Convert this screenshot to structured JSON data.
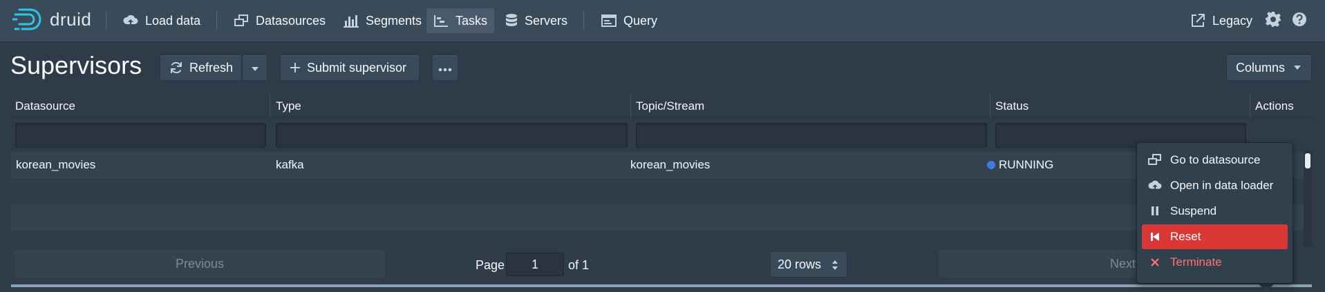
{
  "navbar": {
    "logo_text": "druid",
    "items": [
      {
        "label": "Load data",
        "icon": "cloud-upload-icon"
      },
      {
        "label": "Datasources",
        "icon": "multi-select-icon"
      },
      {
        "label": "Segments",
        "icon": "stacked-chart-icon"
      },
      {
        "label": "Tasks",
        "icon": "gantt-chart-icon",
        "active": true
      },
      {
        "label": "Servers",
        "icon": "database-icon"
      },
      {
        "label": "Query",
        "icon": "application-icon"
      }
    ],
    "legacy_label": "Legacy",
    "accent": "#4a5b6c"
  },
  "header": {
    "title": "Supervisors",
    "refresh_label": "Refresh",
    "submit_label": "Submit supervisor",
    "columns_label": "Columns"
  },
  "table": {
    "columns": [
      "Datasource",
      "Type",
      "Topic/Stream",
      "Status",
      "Actions"
    ],
    "rows": [
      {
        "datasource": "korean_movies",
        "type": "kafka",
        "topic": "korean_movies",
        "status": "RUNNING",
        "status_color": "#3d7ee0"
      }
    ]
  },
  "pagination": {
    "previous_label": "Previous",
    "page_label": "Page",
    "page_value": "1",
    "of_label": "of 1",
    "rows_value": "20 rows",
    "next_label": "Next"
  },
  "actions_menu": {
    "items": [
      {
        "label": "Go to datasource",
        "icon": "multi-select-icon"
      },
      {
        "label": "Open in data loader",
        "icon": "cloud-upload-icon"
      },
      {
        "label": "Suspend",
        "icon": "pause-icon"
      },
      {
        "label": "Reset",
        "icon": "step-backward-icon",
        "color": "#db3737"
      },
      {
        "label": "Terminate",
        "icon": "cross-icon",
        "color": "#ff7373"
      }
    ]
  }
}
